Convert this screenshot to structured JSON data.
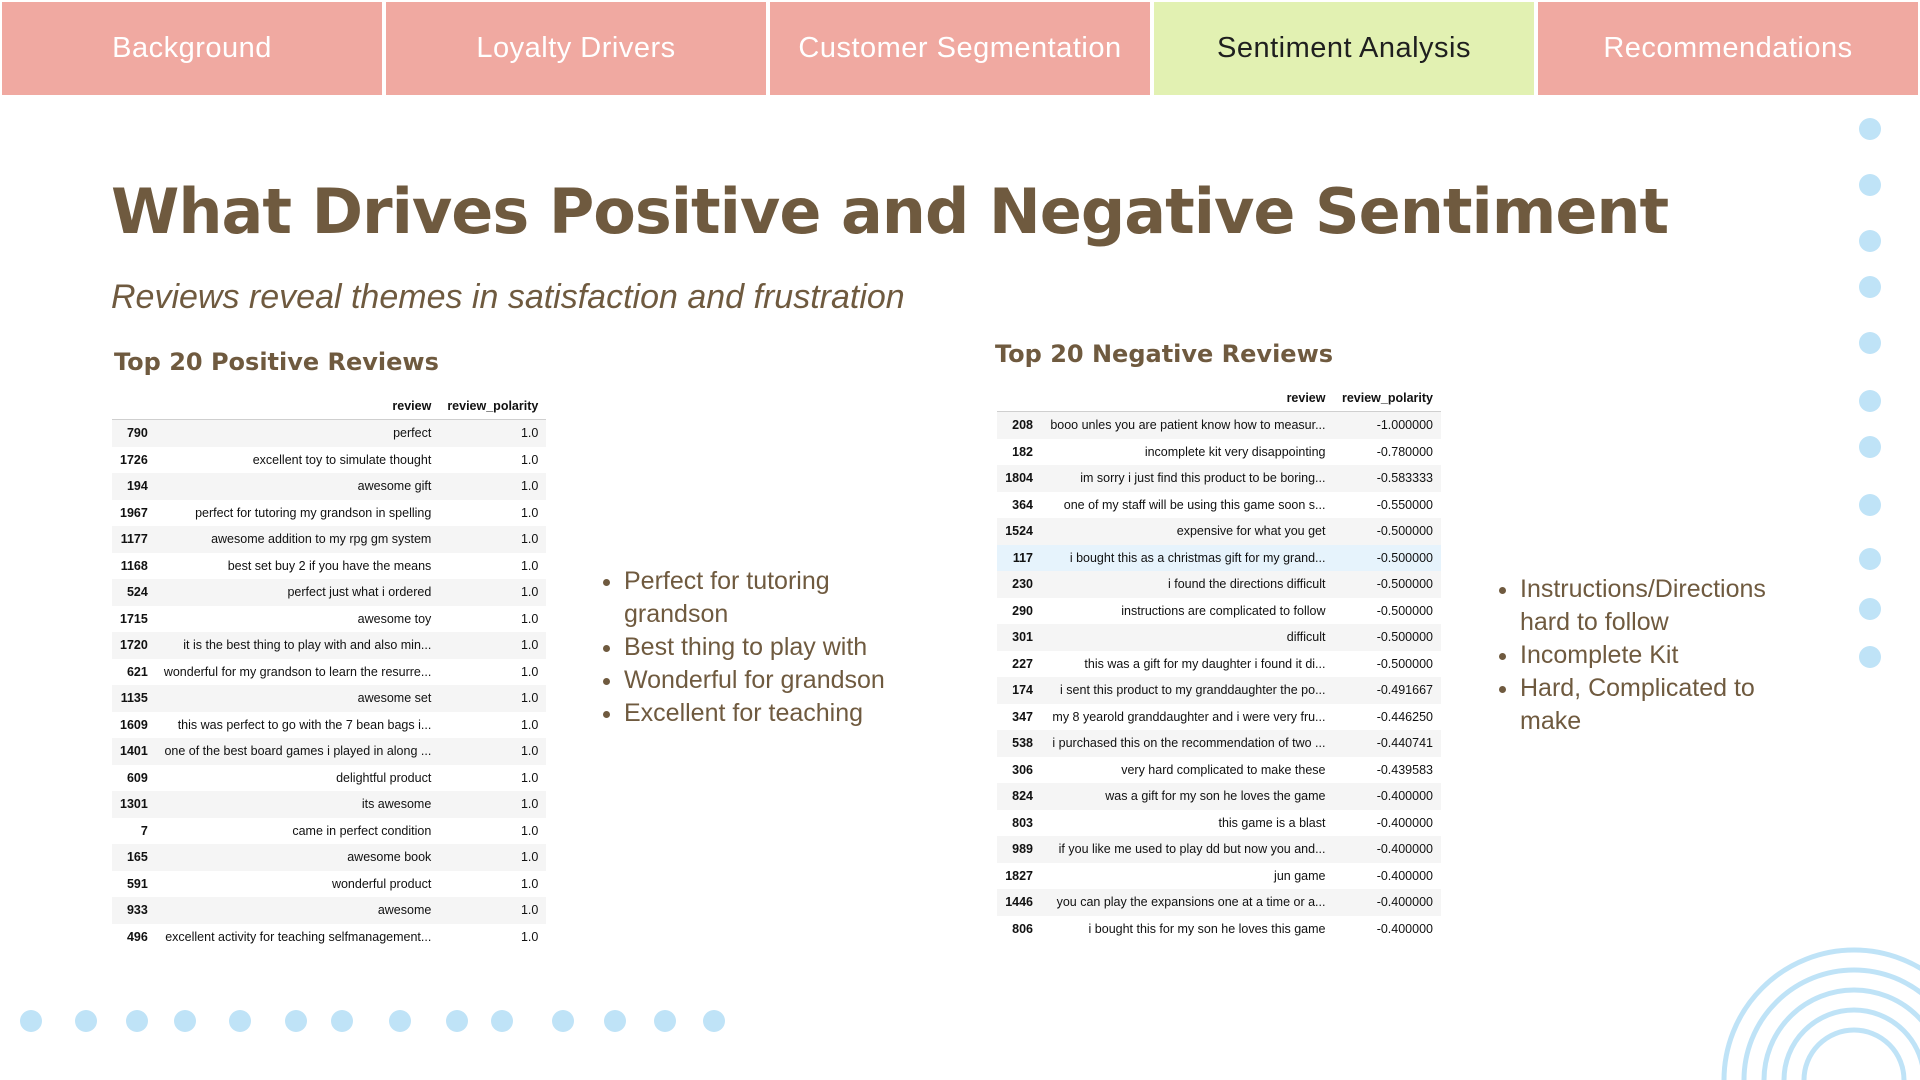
{
  "tabs": [
    {
      "label": "Background"
    },
    {
      "label": "Loyalty Drivers"
    },
    {
      "label": "Customer Segmentation"
    },
    {
      "label": "Sentiment Analysis"
    },
    {
      "label": "Recommendations"
    }
  ],
  "active_tab": "Sentiment Analysis",
  "title": "What Drives Positive and Negative Sentiment",
  "subtitle": "Reviews reveal themes in satisfaction and frustration",
  "positive": {
    "heading": "Top 20 Positive Reviews",
    "columns": [
      "review",
      "review_polarity"
    ],
    "rows": [
      {
        "idx": "790",
        "review": "perfect",
        "polarity": "1.0"
      },
      {
        "idx": "1726",
        "review": "excellent toy to simulate thought",
        "polarity": "1.0"
      },
      {
        "idx": "194",
        "review": "awesome gift",
        "polarity": "1.0"
      },
      {
        "idx": "1967",
        "review": "perfect for tutoring my grandson in spelling",
        "polarity": "1.0"
      },
      {
        "idx": "1177",
        "review": "awesome addition to my rpg gm system",
        "polarity": "1.0"
      },
      {
        "idx": "1168",
        "review": "best set buy 2 if you have the means",
        "polarity": "1.0"
      },
      {
        "idx": "524",
        "review": "perfect just what i ordered",
        "polarity": "1.0"
      },
      {
        "idx": "1715",
        "review": "awesome toy",
        "polarity": "1.0"
      },
      {
        "idx": "1720",
        "review": "it is the best thing to play with and also min...",
        "polarity": "1.0"
      },
      {
        "idx": "621",
        "review": "wonderful for my grandson to learn the resurre...",
        "polarity": "1.0"
      },
      {
        "idx": "1135",
        "review": "awesome set",
        "polarity": "1.0"
      },
      {
        "idx": "1609",
        "review": "this was perfect to go with the 7 bean bags i...",
        "polarity": "1.0"
      },
      {
        "idx": "1401",
        "review": "one of the best board games i played in along ...",
        "polarity": "1.0"
      },
      {
        "idx": "609",
        "review": "delightful product",
        "polarity": "1.0"
      },
      {
        "idx": "1301",
        "review": "its awesome",
        "polarity": "1.0"
      },
      {
        "idx": "7",
        "review": "came in perfect condition",
        "polarity": "1.0"
      },
      {
        "idx": "165",
        "review": "awesome book",
        "polarity": "1.0"
      },
      {
        "idx": "591",
        "review": "wonderful product",
        "polarity": "1.0"
      },
      {
        "idx": "933",
        "review": "awesome",
        "polarity": "1.0"
      },
      {
        "idx": "496",
        "review": "excellent activity for teaching selfmanagement...",
        "polarity": "1.0"
      }
    ],
    "bullets": [
      "Perfect for tutoring grandson",
      "Best thing to play with",
      "Wonderful for grandson",
      "Excellent for teaching"
    ]
  },
  "negative": {
    "heading": "Top 20 Negative Reviews",
    "columns": [
      "review",
      "review_polarity"
    ],
    "highlighted_index": "117",
    "rows": [
      {
        "idx": "208",
        "review": "booo unles you are patient know how to measur...",
        "polarity": "-1.000000"
      },
      {
        "idx": "182",
        "review": "incomplete kit very disappointing",
        "polarity": "-0.780000"
      },
      {
        "idx": "1804",
        "review": "im sorry i just find this product to be boring...",
        "polarity": "-0.583333"
      },
      {
        "idx": "364",
        "review": "one of my staff will be using this game soon s...",
        "polarity": "-0.550000"
      },
      {
        "idx": "1524",
        "review": "expensive for what you get",
        "polarity": "-0.500000"
      },
      {
        "idx": "117",
        "review": "i bought this as a christmas gift for my grand...",
        "polarity": "-0.500000"
      },
      {
        "idx": "230",
        "review": "i found the directions difficult",
        "polarity": "-0.500000"
      },
      {
        "idx": "290",
        "review": "instructions are complicated to follow",
        "polarity": "-0.500000"
      },
      {
        "idx": "301",
        "review": "difficult",
        "polarity": "-0.500000"
      },
      {
        "idx": "227",
        "review": "this was a gift for my daughter i found it di...",
        "polarity": "-0.500000"
      },
      {
        "idx": "174",
        "review": "i sent this product to my granddaughter the po...",
        "polarity": "-0.491667"
      },
      {
        "idx": "347",
        "review": "my 8 yearold granddaughter and i were very fru...",
        "polarity": "-0.446250"
      },
      {
        "idx": "538",
        "review": "i purchased this on the recommendation of two ...",
        "polarity": "-0.440741"
      },
      {
        "idx": "306",
        "review": "very hard complicated to make these",
        "polarity": "-0.439583"
      },
      {
        "idx": "824",
        "review": "was a gift for my son he loves the game",
        "polarity": "-0.400000"
      },
      {
        "idx": "803",
        "review": "this game is a blast",
        "polarity": "-0.400000"
      },
      {
        "idx": "989",
        "review": "if you like me used to play dd but now you and...",
        "polarity": "-0.400000"
      },
      {
        "idx": "1827",
        "review": "jun game",
        "polarity": "-0.400000"
      },
      {
        "idx": "1446",
        "review": "you can play the expansions one at a time or a...",
        "polarity": "-0.400000"
      },
      {
        "idx": "806",
        "review": "i bought this for my son he loves this game",
        "polarity": "-0.400000"
      }
    ],
    "bullets": [
      "Instructions/Directions hard to follow",
      "Incomplete Kit",
      "Hard, Complicated to make"
    ]
  },
  "colors": {
    "tab": "#f0a9a1",
    "tab_active": "#e2f1b2",
    "title": "#6f5a3f",
    "accent_dots": "#bfe3f7"
  }
}
